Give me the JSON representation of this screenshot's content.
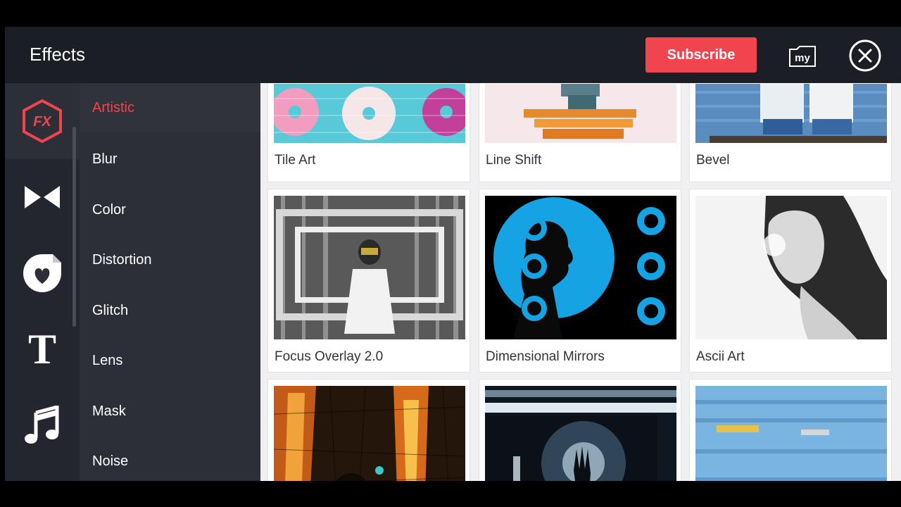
{
  "header": {
    "title": "Effects",
    "subscribe_label": "Subscribe",
    "my_label": "my"
  },
  "rail": [
    {
      "icon": "fx-icon",
      "label": "FX"
    },
    {
      "icon": "transition-icon"
    },
    {
      "icon": "sticker-icon"
    },
    {
      "icon": "text-icon",
      "label": "T"
    },
    {
      "icon": "music-icon",
      "label": "♫"
    }
  ],
  "categories": [
    "Artistic",
    "Blur",
    "Color",
    "Distortion",
    "Glitch",
    "Lens",
    "Mask",
    "Noise"
  ],
  "effects": [
    "Tile Art",
    "Line Shift",
    "Bevel",
    "Focus Overlay 2.0",
    "Dimensional Mirrors",
    "Ascii Art"
  ],
  "colors": {
    "accent": "#f0454e",
    "header_bg": "#1c1e25",
    "panel_bg": "#2c2f37"
  }
}
